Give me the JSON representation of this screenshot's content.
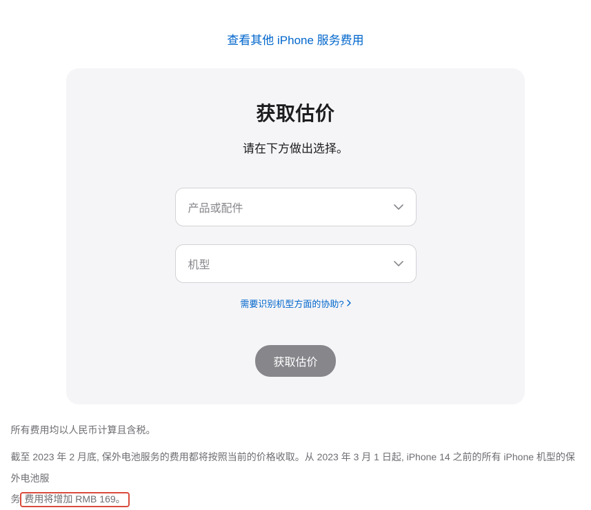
{
  "topLink": {
    "label": "查看其他 iPhone 服务费用"
  },
  "card": {
    "title": "获取估价",
    "subtitle": "请在下方做出选择。",
    "select1": {
      "placeholder": "产品或配件"
    },
    "select2": {
      "placeholder": "机型"
    },
    "helpLink": {
      "label": "需要识别机型方面的协助?"
    },
    "button": {
      "label": "获取估价"
    }
  },
  "footer": {
    "line1": "所有费用均以人民币计算且含税。",
    "line2_a": "截至 2023 年 2 月底, 保外电池服务的费用都将按照当前的价格收取。从 2023 年 3 月 1 日起, iPhone 14 之前的所有 iPhone 机型的保外电池服",
    "line2_b_pre": "务",
    "line2_b_highlight": "费用将增加 RMB 169。"
  }
}
